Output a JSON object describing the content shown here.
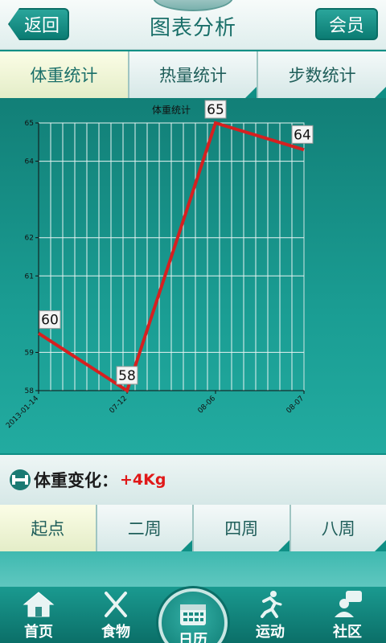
{
  "header": {
    "title": "图表分析",
    "back_label": "返回",
    "member_label": "会员"
  },
  "tabs": [
    {
      "label": "体重统计",
      "active": true
    },
    {
      "label": "热量统计",
      "active": false
    },
    {
      "label": "步数统计",
      "active": false
    }
  ],
  "chart_data": {
    "type": "line",
    "title": "体重统计",
    "categories": [
      "2013-01-14",
      "07-12",
      "08-06",
      "08-07"
    ],
    "values": [
      59.5,
      58,
      65,
      64.3
    ],
    "point_labels": [
      "60",
      "58",
      "65",
      "64"
    ],
    "yticks": [
      58,
      59,
      61,
      62,
      64,
      65
    ],
    "ylim": [
      58,
      65
    ],
    "line_color": "#d62020",
    "grid": true
  },
  "weight_change": {
    "label": "体重变化：",
    "value": "+4Kg",
    "value_color": "#e01818"
  },
  "period_tabs": [
    {
      "label": "起点",
      "active": true
    },
    {
      "label": "二周",
      "active": false
    },
    {
      "label": "四周",
      "active": false
    },
    {
      "label": "八周",
      "active": false
    }
  ],
  "bottom_nav": {
    "home": "首页",
    "food": "食物",
    "calendar": "日历",
    "exercise": "运动",
    "community": "社区"
  }
}
